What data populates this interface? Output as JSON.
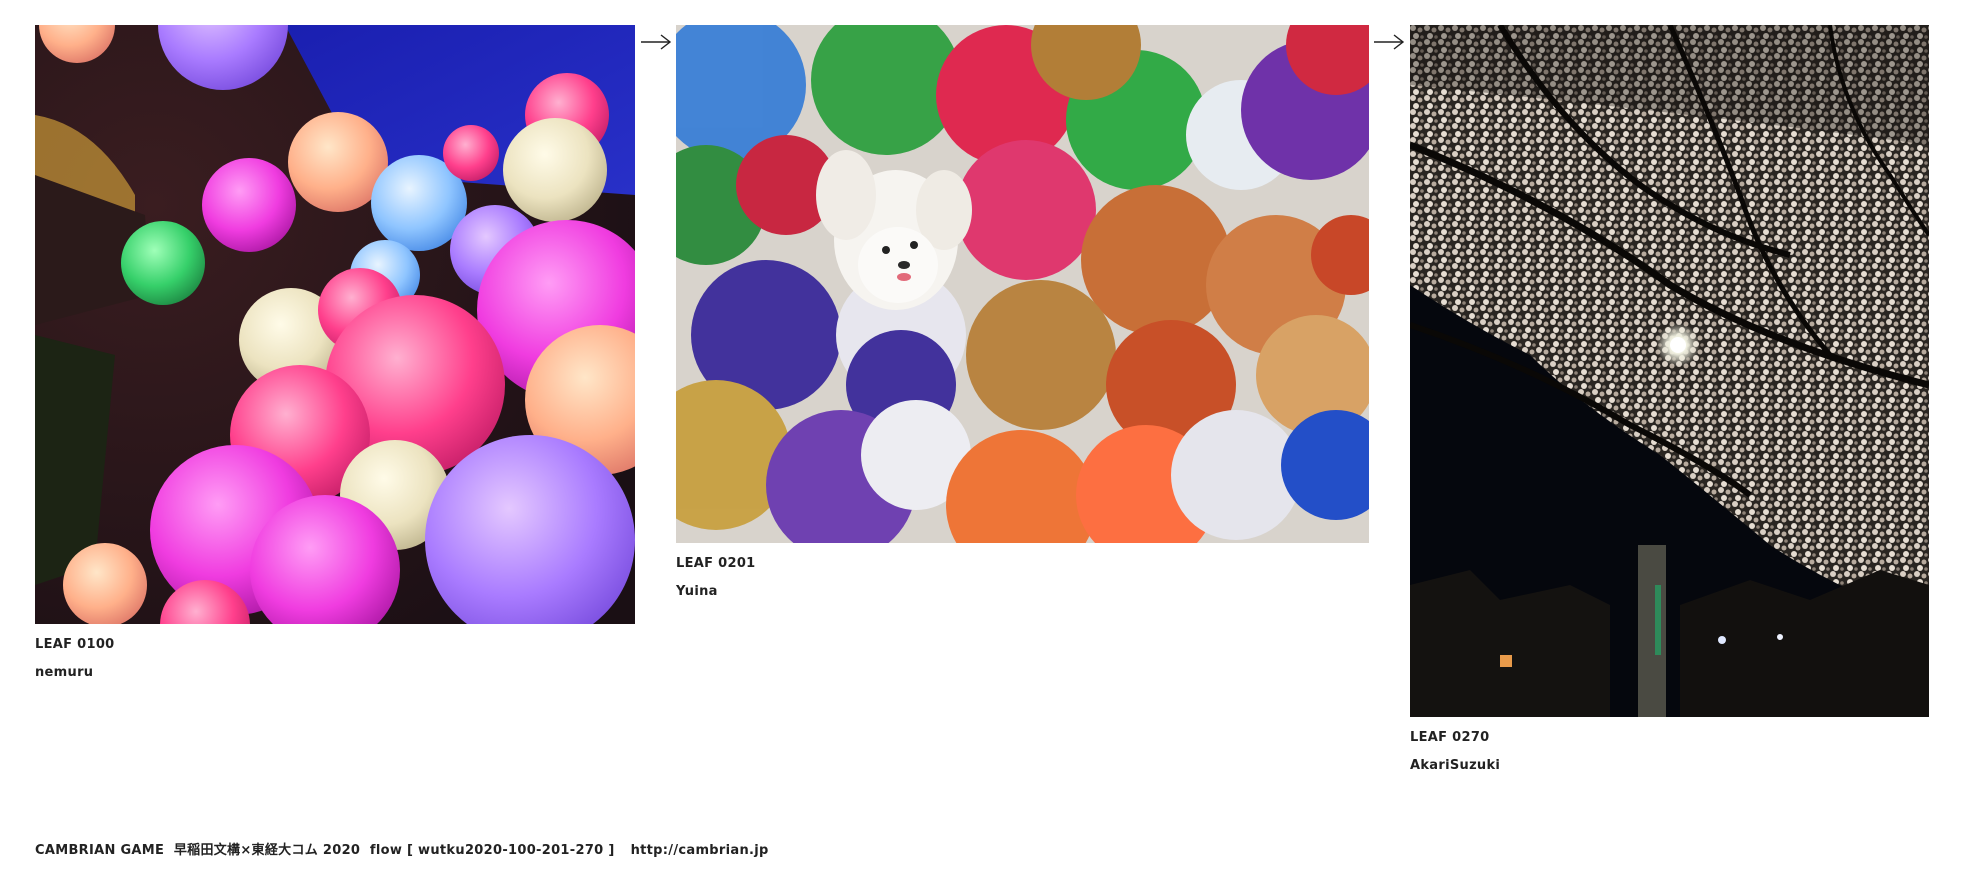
{
  "leaves": [
    {
      "code": "LEAF 0100",
      "author": "nemuru",
      "photo_subject": "glowing colorful balloons"
    },
    {
      "code": "LEAF 0201",
      "author": "Yuina",
      "photo_subject": "white dog among pom-poms"
    },
    {
      "code": "LEAF 0270",
      "author": "AkariSuzuki",
      "photo_subject": "cherry blossoms at night"
    }
  ],
  "footer": {
    "text": "CAMBRIAN GAME  早稲田文構×東経大コム 2020  flow [ wutku2020-100-201-270 ]",
    "link": "http://cambrian.jp"
  },
  "colors": {
    "text": "#222222",
    "background": "#ffffff"
  },
  "icons": {
    "arrow": "right-arrow-icon"
  }
}
